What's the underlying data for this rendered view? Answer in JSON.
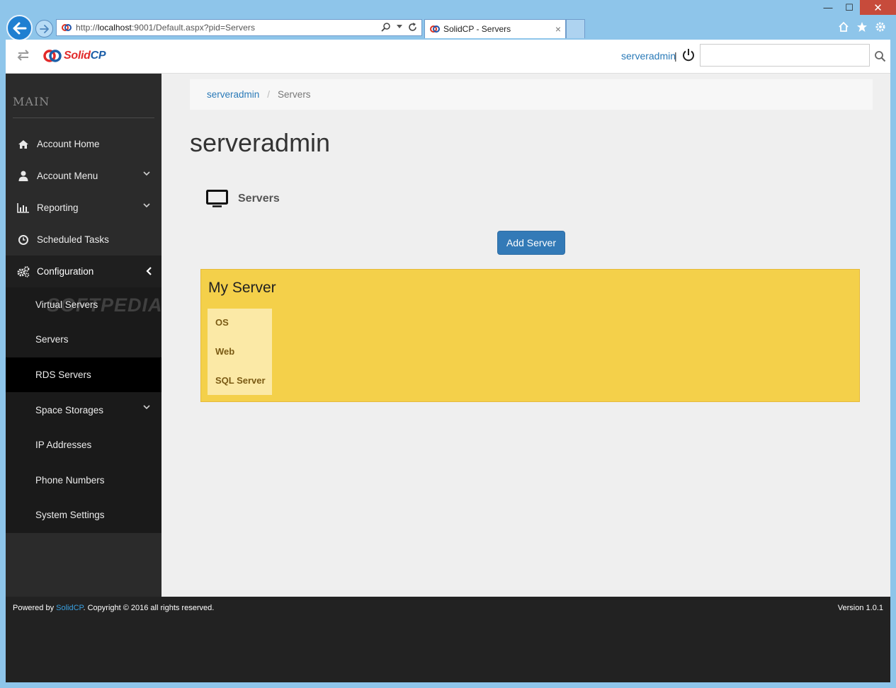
{
  "browser": {
    "url_prefix": "http://",
    "url_host": "localhost",
    "url_rest": ":9001/Default.aspx?pid=Servers",
    "tab_title": "SolidCP - Servers",
    "tab_close": "×",
    "win_min": "—",
    "win_max": "☐",
    "win_close": "✕"
  },
  "topbar": {
    "logo_prefix": "Solid",
    "logo_suffix": "CP",
    "user": "serveradmin",
    "separator": "|",
    "search_placeholder": ""
  },
  "sidebar": {
    "heading": "MAIN",
    "items": [
      {
        "label": "Account Home",
        "icon": "home-icon"
      },
      {
        "label": "Account Menu",
        "icon": "user-icon",
        "expandable": true
      },
      {
        "label": "Reporting",
        "icon": "bar-chart-icon",
        "expandable": true
      },
      {
        "label": "Scheduled Tasks",
        "icon": "clock-icon"
      },
      {
        "label": "Configuration",
        "icon": "gears-icon",
        "expanded": true
      }
    ],
    "sub_items": [
      {
        "label": "Virtual Servers"
      },
      {
        "label": "Servers"
      },
      {
        "label": "RDS Servers",
        "active": true
      },
      {
        "label": "Space Storages",
        "expandable": true
      },
      {
        "label": "IP Addresses"
      },
      {
        "label": "Phone Numbers"
      },
      {
        "label": "System Settings"
      }
    ],
    "watermark": "SOFTPEDIA"
  },
  "main": {
    "breadcrumb": {
      "root": "serveradmin",
      "separator": "/",
      "current": "Servers"
    },
    "title": "serveradmin",
    "section_label": "Servers",
    "add_button": "Add Server",
    "server": {
      "name": "My Server",
      "services": [
        "OS",
        "Web",
        "SQL Server"
      ]
    }
  },
  "footer": {
    "powered_by": "Powered by ",
    "brand": "SolidCP",
    "copyright": ". Copyright © 2016 all rights reserved.",
    "version": "Version 1.0.1"
  },
  "colors": {
    "sidebar_bg": "#2b2b2b",
    "link": "#2a7ab8",
    "primary_button": "#337ab7",
    "server_card": "#f4d04a",
    "footer_bg": "#222222"
  }
}
